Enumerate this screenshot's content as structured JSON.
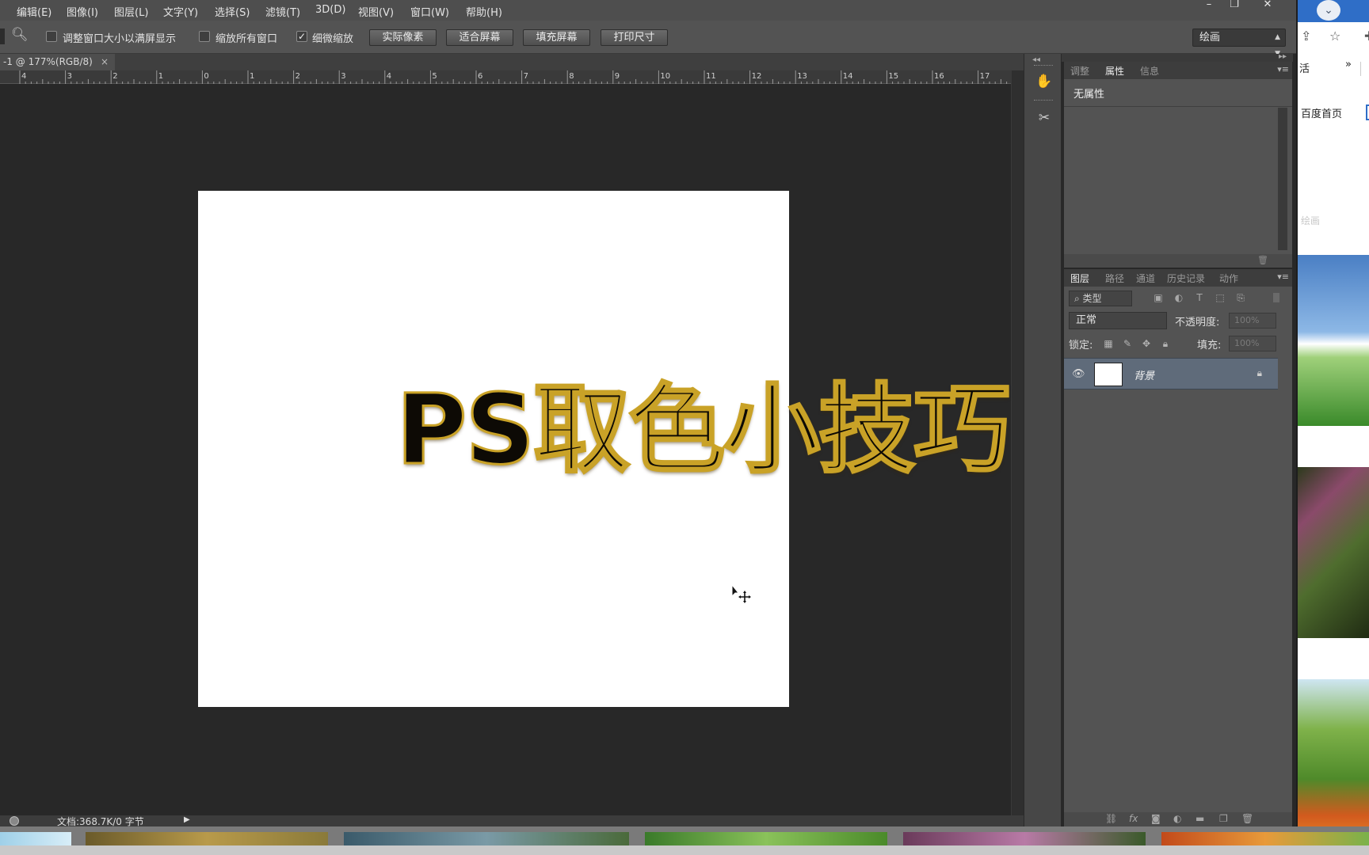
{
  "menubar": {
    "items": [
      "编辑(E)",
      "图像(I)",
      "图层(L)",
      "文字(Y)",
      "选择(S)",
      "滤镜(T)",
      "3D(D)",
      "视图(V)",
      "窗口(W)",
      "帮助(H)"
    ],
    "window_controls": [
      "–",
      "❐",
      "✕"
    ]
  },
  "optionsbar": {
    "resize_windows_label": "调整窗口大小以满屏显示",
    "zoom_all_label": "缩放所有窗口",
    "scrubby_zoom_label": "细微缩放",
    "scrubby_zoom_checked": true,
    "actual_pixels": "实际像素",
    "fit_screen": "适合屏幕",
    "fill_screen": "填充屏幕",
    "print_size": "打印尺寸",
    "workspace": "绘画"
  },
  "document": {
    "tab_title": "-1 @ 177%(RGB/8)",
    "tab_close": "×",
    "headline": "PS取色小技巧",
    "ruler_labels": [
      "4",
      "3",
      "2",
      "1",
      "0",
      "1",
      "2",
      "3",
      "4",
      "5",
      "6",
      "7",
      "8",
      "9",
      "10",
      "11",
      "12",
      "13",
      "14",
      "15",
      "16",
      "17"
    ]
  },
  "status": {
    "doc_info": "文档:368.7K/0 字节",
    "arrow": "▶"
  },
  "properties_panel": {
    "tabs": [
      "调整",
      "属性",
      "信息"
    ],
    "active_tab": "属性",
    "title": "无属性"
  },
  "layers_panel": {
    "tabs": [
      "图层",
      "路径",
      "通道",
      "历史记录",
      "动作"
    ],
    "active_tab": "图层",
    "kind_filter": "类型",
    "blend_mode": "正常",
    "opacity_label": "不透明度:",
    "opacity_value": "100%",
    "lock_label": "锁定:",
    "fill_label": "填充:",
    "fill_value": "100%",
    "layers": [
      {
        "name": "背景",
        "locked": true,
        "visible": true
      }
    ]
  },
  "browser_fragment": {
    "partial_label": "活",
    "chevron": "»",
    "link": "百度首页",
    "faded_label": "绘画"
  },
  "colors": {
    "menubar": "#4e4e4e",
    "options_bar": "#535353",
    "canvas_bg": "#282828",
    "panel": "#535353",
    "selected_layer": "#5f6b7a",
    "headline_outline": "#c9a227"
  }
}
